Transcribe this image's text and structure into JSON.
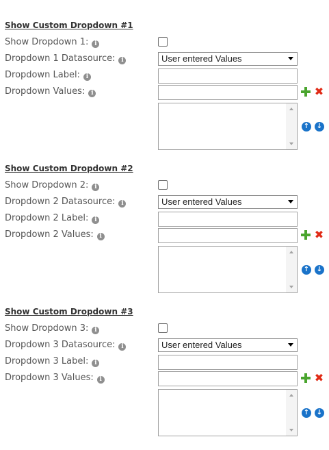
{
  "sections": [
    {
      "title": "Show Custom Dropdown #1",
      "show_label": "Show Dropdown 1:",
      "datasource_label": "Dropdown 1 Datasource:",
      "datasource_value": "User entered Values",
      "label_label": "Dropdown Label:",
      "values_label": "Dropdown Values:"
    },
    {
      "title": "Show Custom Dropdown #2",
      "show_label": "Show Dropdown 2:",
      "datasource_label": "Dropdown 2 Datasource:",
      "datasource_value": "User entered Values",
      "label_label": "Dropdown 2 Label:",
      "values_label": "Dropdown 2 Values:"
    },
    {
      "title": "Show Custom Dropdown #3",
      "show_label": "Show Dropdown 3:",
      "datasource_label": "Dropdown 3 Datasource:",
      "datasource_value": "User entered Values",
      "label_label": "Dropdown 3 Label:",
      "values_label": "Dropdown 3 Values:"
    }
  ],
  "icons": {
    "info": "info-icon",
    "add": "plus-icon",
    "delete": "x-icon",
    "move_up": "arrow-up-circle-icon",
    "move_down": "arrow-down-circle-icon"
  },
  "colors": {
    "add": "#4aa52e",
    "delete": "#e02b16",
    "move": "#1a73c9",
    "info": "#8f8f8f"
  }
}
